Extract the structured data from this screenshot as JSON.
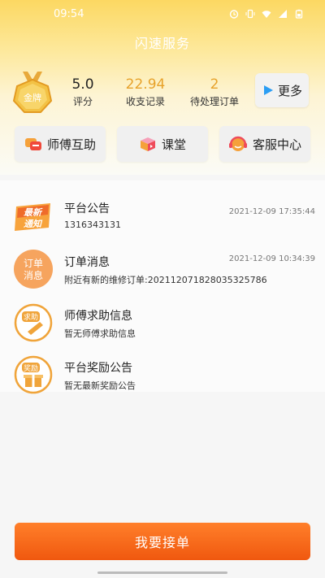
{
  "status_bar": {
    "time": "09:54"
  },
  "header": {
    "title": "闪速服务"
  },
  "medal": {
    "text": "金牌"
  },
  "stats": [
    {
      "value": "5.0",
      "label": "评分"
    },
    {
      "value": "22.94",
      "label": "收支记录"
    },
    {
      "value": "2",
      "label": "待处理订单"
    }
  ],
  "more_button": {
    "label": "更多"
  },
  "quick_actions": [
    {
      "label": "师傅互助",
      "icon": "chat-bubbles-icon"
    },
    {
      "label": "课堂",
      "icon": "play-box-icon"
    },
    {
      "label": "客服中心",
      "icon": "headset-icon"
    }
  ],
  "notices": [
    {
      "title": "平台公告",
      "subtitle": "1316343131",
      "time": "2021-12-09 17:35:44",
      "icon_text_1": "最新",
      "icon_text_2": "通知"
    },
    {
      "title": "订单消息",
      "subtitle": "附近有新的维修订单:20211207182803532​5786",
      "time": "2021-12-09 10:34:39",
      "icon_text_1": "订单",
      "icon_text_2": "消息"
    },
    {
      "title": "师傅求助信息",
      "subtitle": "暂无师傅求助信息",
      "time": "",
      "icon_text_1": "求助",
      "icon_text_2": ""
    },
    {
      "title": "平台奖励公告",
      "subtitle": "暂无最新奖励公告",
      "time": "",
      "icon_text_1": "奖励",
      "icon_text_2": ""
    }
  ],
  "cta": {
    "label": "我要接单"
  },
  "colors": {
    "accent": "#fcd862",
    "orange": "#f0580f",
    "gold": "#e7a22a"
  }
}
